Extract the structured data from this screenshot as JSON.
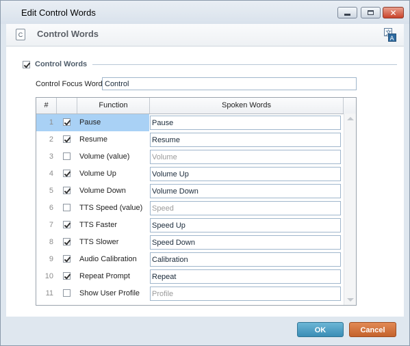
{
  "window": {
    "title": "Edit Control Words",
    "minimize_icon": "minimize-icon",
    "maximize_icon": "maximize-icon",
    "close_icon": "close-icon"
  },
  "header": {
    "icon_letter": "C",
    "title": "Control Words",
    "translate_icon": "translate-icon"
  },
  "group": {
    "label": "Control Words",
    "checked": true
  },
  "focus_word": {
    "label": "Control Focus Word",
    "value": "Control"
  },
  "grid": {
    "columns": [
      "#",
      "",
      "Function",
      "Spoken Words"
    ],
    "rows": [
      {
        "num": "1",
        "checked": true,
        "function": "Pause",
        "spoken": "Pause",
        "placeholder": "",
        "selected": true
      },
      {
        "num": "2",
        "checked": true,
        "function": "Resume",
        "spoken": "Resume",
        "placeholder": "",
        "selected": false
      },
      {
        "num": "3",
        "checked": false,
        "function": "Volume (value)",
        "spoken": "",
        "placeholder": "Volume",
        "selected": false
      },
      {
        "num": "4",
        "checked": true,
        "function": "Volume Up",
        "spoken": "Volume Up",
        "placeholder": "",
        "selected": false
      },
      {
        "num": "5",
        "checked": true,
        "function": "Volume Down",
        "spoken": "Volume Down",
        "placeholder": "",
        "selected": false
      },
      {
        "num": "6",
        "checked": false,
        "function": "TTS Speed (value)",
        "spoken": "",
        "placeholder": "Speed",
        "selected": false
      },
      {
        "num": "7",
        "checked": true,
        "function": "TTS Faster",
        "spoken": "Speed Up",
        "placeholder": "",
        "selected": false
      },
      {
        "num": "8",
        "checked": true,
        "function": "TTS Slower",
        "spoken": "Speed Down",
        "placeholder": "",
        "selected": false
      },
      {
        "num": "9",
        "checked": true,
        "function": "Audio Calibration",
        "spoken": "Calibration",
        "placeholder": "",
        "selected": false
      },
      {
        "num": "10",
        "checked": true,
        "function": "Repeat Prompt",
        "spoken": "Repeat",
        "placeholder": "",
        "selected": false
      },
      {
        "num": "11",
        "checked": false,
        "function": "Show User Profile",
        "spoken": "",
        "placeholder": "Profile",
        "selected": false
      }
    ]
  },
  "buttons": {
    "ok": "OK",
    "cancel": "Cancel"
  },
  "colors": {
    "ok": "#3a8db5",
    "cancel": "#c4622c",
    "selected_row": "#a9d1f5"
  }
}
